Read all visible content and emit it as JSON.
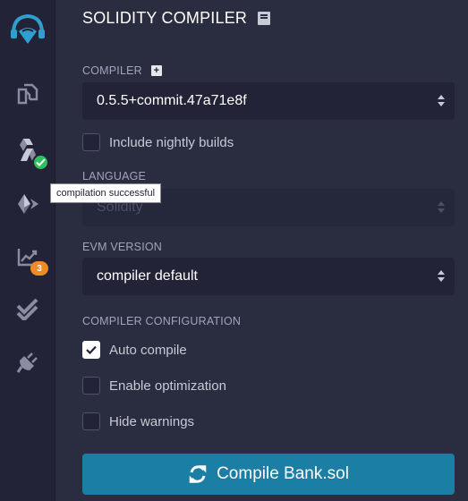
{
  "sidebar": {
    "items": [
      {
        "name": "logo-icon"
      },
      {
        "name": "file-explorer-icon"
      },
      {
        "name": "solidity-compiler-icon",
        "status": "compilation successful"
      },
      {
        "name": "deploy-run-icon"
      },
      {
        "name": "analysis-icon",
        "badge": "3"
      },
      {
        "name": "testing-icon"
      },
      {
        "name": "plugin-manager-icon"
      }
    ],
    "tooltip": "compilation successful",
    "analysis_badge": "3"
  },
  "panel": {
    "title": "SOLIDITY COMPILER",
    "compiler_label": "COMPILER",
    "compiler_value": "0.5.5+commit.47a71e8f",
    "nightly_label": "Include nightly builds",
    "nightly_checked": false,
    "language_label": "LANGUAGE",
    "language_value": "Solidity",
    "evm_label": "EVM VERSION",
    "evm_value": "compiler default",
    "config_label": "COMPILER CONFIGURATION",
    "options": [
      {
        "label": "Auto compile",
        "checked": true
      },
      {
        "label": "Enable optimization",
        "checked": false
      },
      {
        "label": "Hide warnings",
        "checked": false
      }
    ],
    "compile_button": "Compile Bank.sol"
  },
  "colors": {
    "accent": "#1b7ea4",
    "success": "#2fbf5f",
    "warning_badge": "#f08a24",
    "panel_bg": "#2a2c3f",
    "sidebar_bg": "#222336"
  }
}
